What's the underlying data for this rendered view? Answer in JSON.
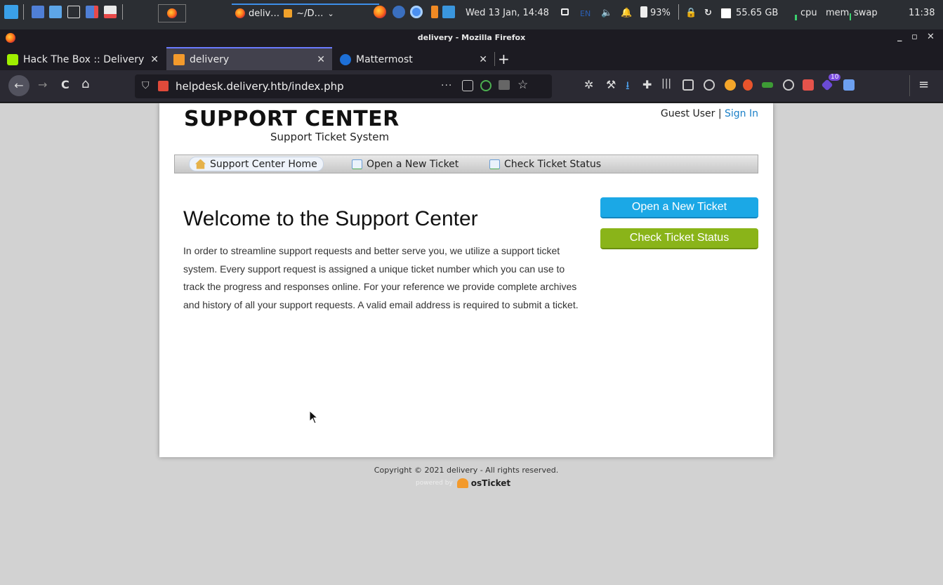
{
  "panel": {
    "window_title_1": "deliv…",
    "window_title_2": "~/D…",
    "datetime": "Wed 13 Jan, 14:48",
    "kbd_layout": "EN",
    "battery": "93%",
    "disk": "55.65 GB",
    "cpu_label": "cpu",
    "mem_label": "mem",
    "swap_label": "swap",
    "time": "11:38"
  },
  "window": {
    "title": "delivery - Mozilla Firefox",
    "minimize": "_",
    "maximize": "▫",
    "close": "✕"
  },
  "tabs": [
    {
      "label": "Hack The Box :: Delivery",
      "close": "✕"
    },
    {
      "label": "delivery",
      "close": "✕",
      "active": true
    },
    {
      "label": "Mattermost",
      "close": "✕"
    }
  ],
  "newtab": "+",
  "navbar": {
    "back": "←",
    "forward": "→",
    "reload": "C",
    "home": "⌂",
    "url": "helpdesk.delivery.htb/index.php",
    "page_actions": "···",
    "menu": "≡",
    "addon_badge": "10"
  },
  "page": {
    "logo_title": "SUPPORT CENTER",
    "logo_subtitle": "Support Ticket System",
    "guest": "Guest User",
    "separator": "|",
    "sign_in": "Sign In",
    "nav": {
      "home": "Support Center Home",
      "open": "Open a New Ticket",
      "check": "Check Ticket Status"
    },
    "welcome_title": "Welcome to the Support Center",
    "intro": "In order to streamline support requests and better serve you, we utilize a support ticket system. Every support request is assigned a unique ticket number which you can use to track the progress and responses online. For your reference we provide complete archives and history of all your support requests. A valid email address is required to submit a ticket.",
    "btn_open": "Open a New Ticket",
    "btn_check": "Check Ticket Status",
    "footer": "Copyright © 2021 delivery - All rights reserved.",
    "powered_by": "powered by",
    "osticket": "osTicket"
  },
  "colors": {
    "link": "#1a7fc7",
    "open_button": "#1ba8e6",
    "check_button": "#8ab419",
    "tab_accent": "#6a7aff"
  }
}
